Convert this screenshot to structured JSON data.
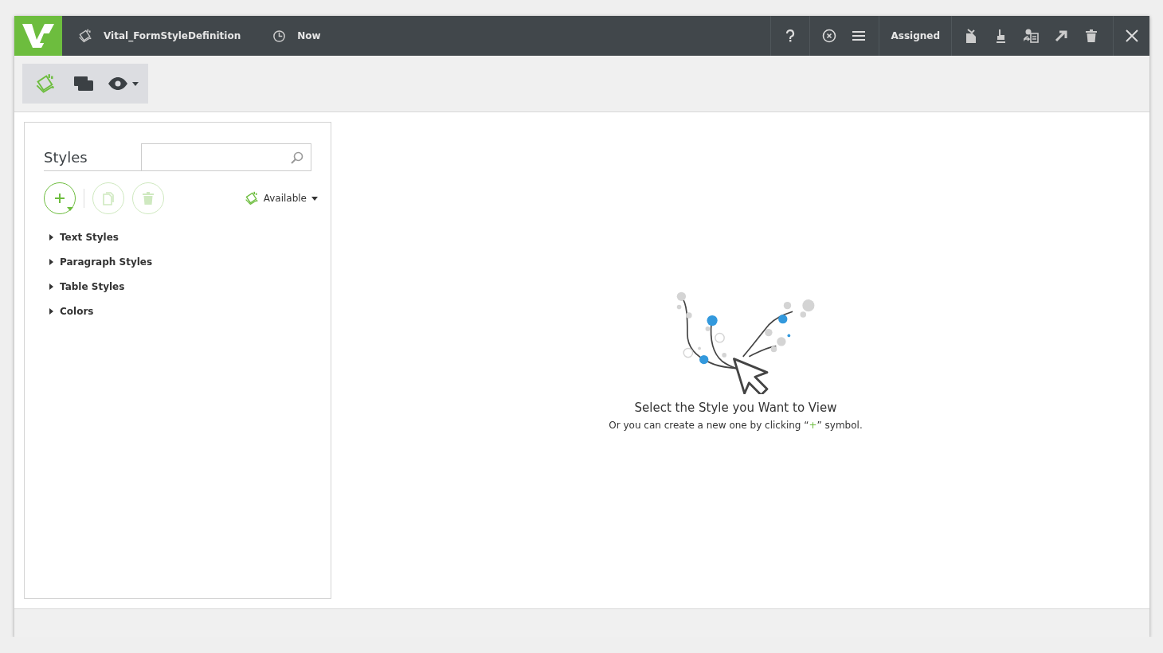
{
  "header": {
    "document_title": "Vital_FormStyleDefinition",
    "time_label": "Now",
    "status_label": "Assigned"
  },
  "toolbar": {
    "items": [
      {
        "kind": "styles",
        "selected": true
      },
      {
        "kind": "windows",
        "selected": false
      },
      {
        "kind": "view",
        "selected": false
      }
    ]
  },
  "styles_panel": {
    "title": "Styles",
    "actions": [
      {
        "kind": "add",
        "disabled": false
      },
      {
        "kind": "copy",
        "disabled": true
      },
      {
        "kind": "delete",
        "disabled": true
      }
    ],
    "filter": {
      "label": "Available"
    },
    "tree": [
      {
        "label": "Text Styles",
        "expanded": false
      },
      {
        "label": "Paragraph Styles",
        "expanded": false
      },
      {
        "label": "Table Styles",
        "expanded": false
      },
      {
        "label": "Colors",
        "expanded": false
      }
    ]
  },
  "empty_state": {
    "title": "Select the Style you Want to View",
    "subtitle": "Or you can create a new one by clicking “**+**” symbol."
  }
}
